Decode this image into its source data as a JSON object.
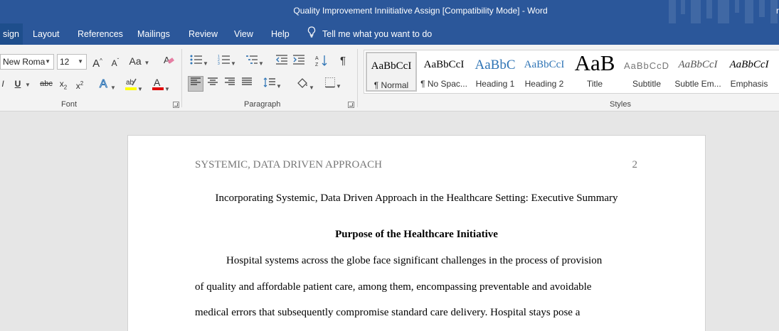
{
  "window": {
    "title": "Quality Improvement Inniitiative Assign [Compatibility Mode]  -  Word",
    "user_initial": "r"
  },
  "tabs": [
    {
      "label": "sign",
      "active": true
    },
    {
      "label": "Layout"
    },
    {
      "label": "References"
    },
    {
      "label": "Mailings"
    },
    {
      "label": "Review"
    },
    {
      "label": "View"
    },
    {
      "label": "Help"
    }
  ],
  "tell_me": "Tell me what you want to do",
  "font": {
    "name": "New Roma",
    "size": "12",
    "group_label": "Font"
  },
  "paragraph": {
    "group_label": "Paragraph"
  },
  "styles_group": {
    "group_label": "Styles",
    "items": [
      {
        "sample": "AaBbCcI",
        "label": "¶ Normal"
      },
      {
        "sample": "AaBbCcI",
        "label": "¶ No Spac..."
      },
      {
        "sample": "AaBbC",
        "label": "Heading 1"
      },
      {
        "sample": "AaBbCcI",
        "label": "Heading 2"
      },
      {
        "sample": "AaB",
        "label": "Title"
      },
      {
        "sample": "AaBbCcD",
        "label": "Subtitle"
      },
      {
        "sample": "AaBbCcI",
        "label": "Subtle Em..."
      },
      {
        "sample": "AaBbCcI",
        "label": "Emphasis"
      }
    ]
  },
  "document": {
    "running_head": "SYSTEMIC, DATA DRIVEN APPROACH",
    "page_number": "2",
    "title": "Incorporating Systemic, Data Driven Approach in the Healthcare Setting: Executive Summary",
    "heading": "Purpose of the Healthcare Initiative",
    "lines": [
      "Hospital systems across the globe face significant challenges in the process of provision",
      "of quality and affordable patient care, among them, encompassing preventable and avoidable",
      "medical errors that subsequently compromise standard care delivery. Hospital stays pose a"
    ]
  },
  "colors": {
    "titlebar": "#2b579a",
    "highlight": "#ffff00",
    "font_color": "#e00000",
    "heading_blue": "#2e74b5"
  }
}
